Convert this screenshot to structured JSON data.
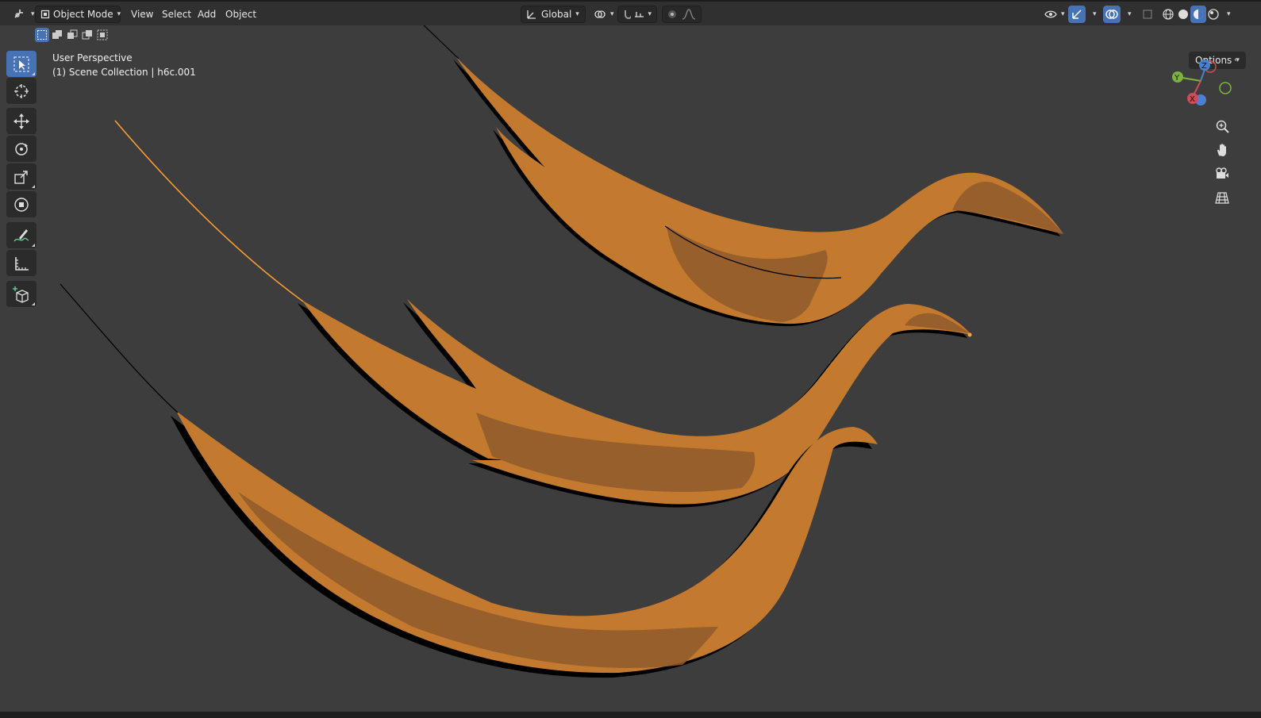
{
  "header": {
    "mode_label": "Object Mode",
    "menu": [
      "View",
      "Select",
      "Add",
      "Object"
    ],
    "transform_orientation": "Global",
    "options_label": "Options"
  },
  "viewport": {
    "view_name": "User Perspective",
    "collection_info": "(1) Scene Collection | h6c.001",
    "background_color": "#3d3d3d",
    "object_color": "#c47a2e",
    "shadow_color": "#8f5a2a",
    "selection_color": "#ffa033"
  },
  "gizmo": {
    "z_label": "Z",
    "y_label": "Y",
    "x_label": "X"
  },
  "icons": {
    "editor_type": "editor-type-icon",
    "tools": [
      "select-box-icon",
      "cursor-icon",
      "move-icon",
      "rotate-icon",
      "scale-icon",
      "transform-icon",
      "annotate-icon",
      "measure-icon",
      "add-cube-icon"
    ],
    "nav": [
      "zoom-icon",
      "pan-hand-icon",
      "camera-icon",
      "grid-icon"
    ]
  }
}
